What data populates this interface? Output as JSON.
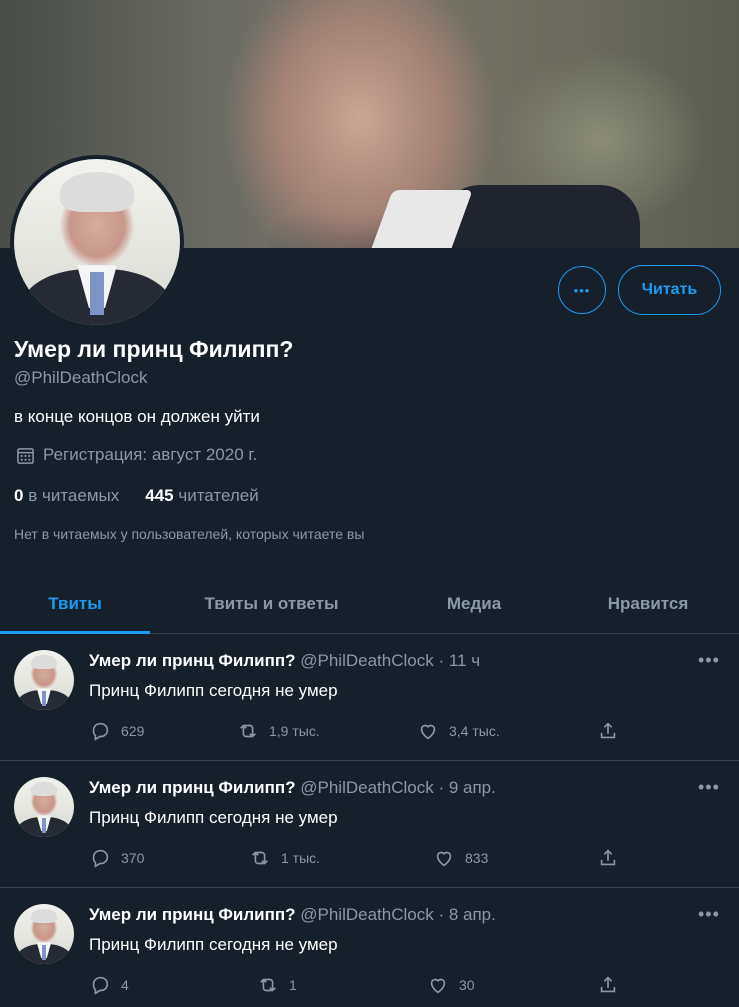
{
  "profile": {
    "name": "Умер ли принц Филипп?",
    "handle": "@PhilDeathClock",
    "bio": "в конце концов он должен уйти",
    "joined": "Регистрация: август 2020 г.",
    "following_count": "0",
    "following_label": "в читаемых",
    "followers_count": "445",
    "followers_label": "читателей",
    "mutual_note": "Нет в читаемых у пользователей, которых читаете вы",
    "follow_label": "Читать",
    "more_label": "•••"
  },
  "tabs": [
    {
      "label": "Твиты",
      "active": true
    },
    {
      "label": "Твиты и ответы",
      "active": false
    },
    {
      "label": "Медиа",
      "active": false
    },
    {
      "label": "Нравится",
      "active": false
    }
  ],
  "tweets": [
    {
      "name": "Умер ли принц Филипп?",
      "meta": "@PhilDeathClock · 11 ч",
      "text": "Принц Филипп сегодня не умер",
      "replies": "629",
      "retweets": "1,9 тыс.",
      "likes": "3,4 тыс."
    },
    {
      "name": "Умер ли принц Филипп?",
      "meta": "@PhilDeathClock · 9 апр.",
      "text": "Принц Филипп сегодня не умер",
      "replies": "370",
      "retweets": "1 тыс.",
      "likes": "833"
    },
    {
      "name": "Умер ли принц Филипп?",
      "meta": "@PhilDeathClock · 8 апр.",
      "text": "Принц Филипп сегодня не умер",
      "replies": "4",
      "retweets": "1",
      "likes": "30"
    }
  ],
  "tweet_more_label": "•••",
  "colors": {
    "accent": "#1d9bf0",
    "background": "#15202b",
    "muted": "#8b98a5"
  }
}
